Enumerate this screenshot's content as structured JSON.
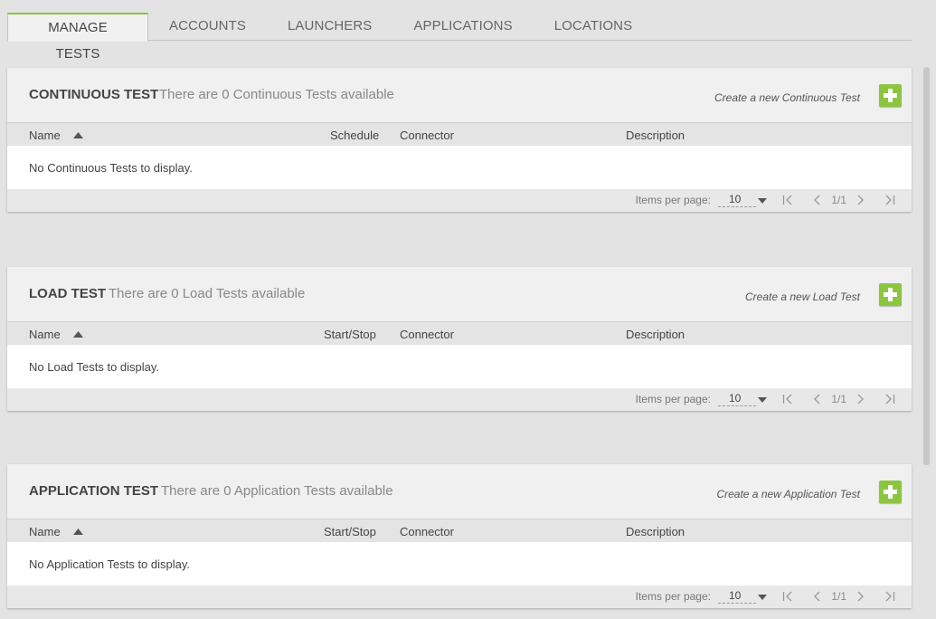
{
  "tabs": [
    {
      "label": "MANAGE TESTS",
      "active": true
    },
    {
      "label": "ACCOUNTS",
      "active": false
    },
    {
      "label": "LAUNCHERS",
      "active": false
    },
    {
      "label": "APPLICATIONS",
      "active": false
    },
    {
      "label": "LOCATIONS",
      "active": false
    }
  ],
  "panels": [
    {
      "title": "CONTINUOUS TEST",
      "subtitle": "There are 0 Continuous Tests available",
      "create_label": "Create a new Continuous Test",
      "columns": [
        "Name",
        "Schedule",
        "Connector",
        "Description"
      ],
      "empty_text": "No Continuous Tests to display.",
      "items_per_page_label": "Items per page:",
      "items_per_page": "10",
      "page": "1/1"
    },
    {
      "title": "LOAD TEST",
      "subtitle": "There are 0 Load Tests available",
      "create_label": "Create a new Load Test",
      "columns": [
        "Name",
        "Start/Stop",
        "Connector",
        "Description"
      ],
      "empty_text": "No Load Tests to display.",
      "items_per_page_label": "Items per page:",
      "items_per_page": "10",
      "page": "1/1"
    },
    {
      "title": "APPLICATION TEST",
      "subtitle": "There are 0 Application Tests available",
      "create_label": "Create a new Application Test",
      "columns": [
        "Name",
        "Start/Stop",
        "Connector",
        "Description"
      ],
      "empty_text": "No Application Tests to display.",
      "items_per_page_label": "Items per page:",
      "items_per_page": "10",
      "page": "1/1"
    }
  ],
  "icons": {
    "add": "plus-icon",
    "sort": "sort-ascending-icon",
    "first": "first-page-icon",
    "prev": "previous-page-icon",
    "next": "next-page-icon",
    "last": "last-page-icon",
    "caret": "caret-down-icon"
  },
  "colors": {
    "accent": "#8cc63f",
    "background": "#e3e3e3",
    "panel": "#f0f0f0"
  }
}
